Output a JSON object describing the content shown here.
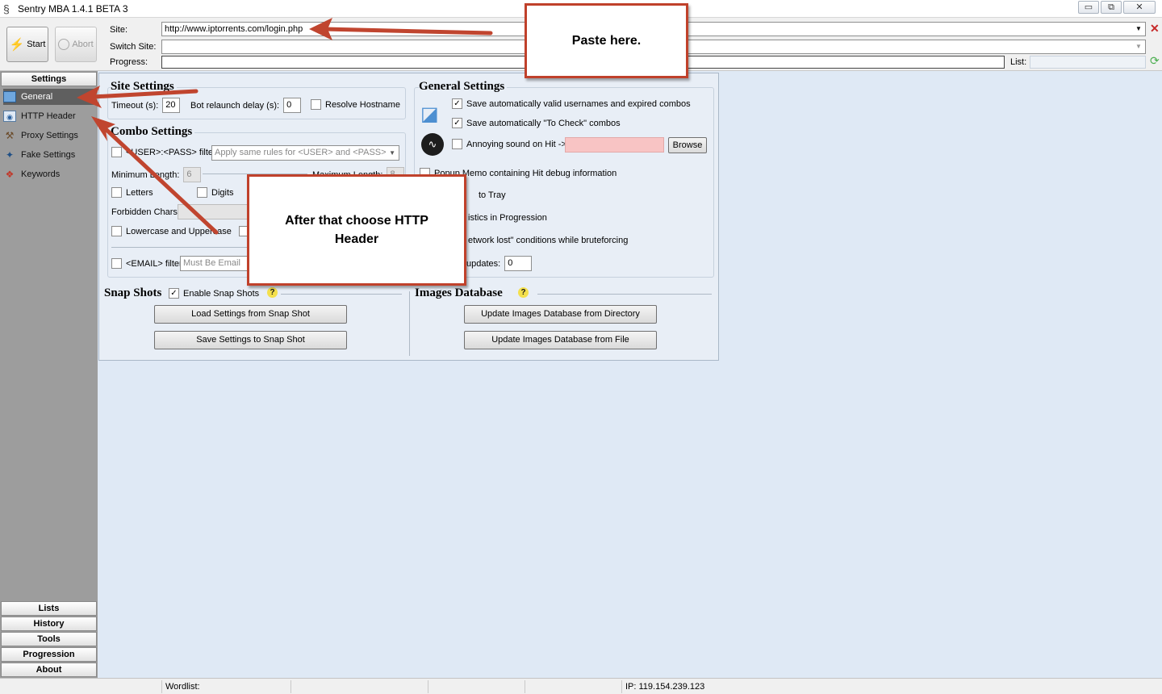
{
  "window": {
    "title": "Sentry MBA 1.4.1 BETA 3",
    "min_glyph": "▭",
    "max_glyph": "⧉",
    "close_glyph": "✕"
  },
  "toolbar": {
    "start_label": "Start",
    "abort_label": "Abort",
    "site_label": "Site:",
    "site_value": "http://www.iptorrents.com/login.php",
    "switch_site_label": "Switch Site:",
    "switch_site_value": "",
    "progress_label": "Progress:",
    "list_label": "List:"
  },
  "sidebar": {
    "header": "Settings",
    "items": [
      {
        "label": "General",
        "icon": "monitor-icon"
      },
      {
        "label": "HTTP Header",
        "icon": "http-header-icon"
      },
      {
        "label": "Proxy Settings",
        "icon": "hammer-icon"
      },
      {
        "label": "Fake Settings",
        "icon": "fake-settings-icon"
      },
      {
        "label": "Keywords",
        "icon": "keywords-icon"
      }
    ],
    "bottom": [
      "Lists",
      "History",
      "Tools",
      "Progression",
      "About"
    ]
  },
  "site_settings": {
    "title": "Site Settings",
    "timeout_label": "Timeout (s):",
    "timeout_value": "20",
    "relaunch_label": "Bot relaunch delay (s):",
    "relaunch_value": "0",
    "resolve_label": "Resolve Hostname",
    "resolve_checked": false
  },
  "combo_settings": {
    "title": "Combo Settings",
    "userpass_filter_label": "<USER>:<PASS> filter:",
    "userpass_filter_value": "Apply same rules for <USER> and <PASS>",
    "min_length_label": "Minimum Length:",
    "min_length_value": "6",
    "max_length_label": "Maximum Length:",
    "max_length_value": "8",
    "letters_label": "Letters",
    "digits_label": "Digits",
    "forbidden_label": "Forbidden Chars:",
    "lowerupper_label": "Lowercase and Uppercase",
    "email_filter_label": "<EMAIL> filter:",
    "email_filter_value": "Must Be Email"
  },
  "general_settings": {
    "title": "General Settings",
    "save_valid_label": "Save automatically valid usernames and expired combos",
    "save_valid_checked": true,
    "save_tocheck_label": "Save automatically \"To Check\" combos",
    "save_tocheck_checked": true,
    "sound_label": "Annoying sound on Hit ->",
    "browse_label": "Browse",
    "popup_label": "Popup Memo containing Hit debug information",
    "tray_label": "to Tray",
    "stats_label": "istics in Progression",
    "network_label": "etwork lost\" conditions while bruteforcing",
    "updates_label": "updates:",
    "updates_value": "0"
  },
  "snapshots": {
    "title": "Snap Shots",
    "enable_label": "Enable Snap Shots",
    "enable_checked": true,
    "help_icon": "?",
    "load_btn": "Load Settings from Snap Shot",
    "save_btn": "Save Settings to Snap Shot"
  },
  "images_db": {
    "title": "Images Database",
    "help_icon": "?",
    "update_dir_btn": "Update Images Database from Directory",
    "update_file_btn": "Update Images Database from File"
  },
  "statusbar": {
    "wordlist_label": "Wordlist:",
    "ip_label": "IP: 119.154.239.123"
  },
  "callouts": {
    "paste": "Paste here.",
    "choose_http": "After that choose HTTP Header"
  },
  "colors": {
    "callout_border": "#c0412b",
    "arrow": "#c0452f",
    "sound_field": "#f8c4c4",
    "sidebar_bg": "#9d9d9d"
  }
}
